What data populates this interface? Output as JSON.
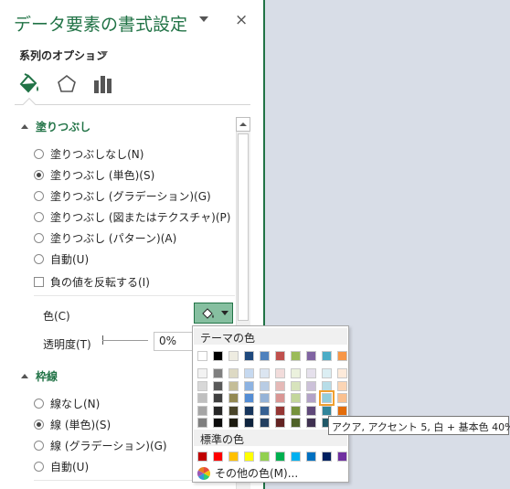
{
  "pane": {
    "title": "データ要素の書式設定",
    "close_glyph": "×",
    "series_options_label": "系列のオプション",
    "tabs": [
      {
        "icon": "paint-bucket-icon",
        "selected": true
      },
      {
        "icon": "pentagon-icon",
        "selected": false
      },
      {
        "icon": "bar-chart-icon",
        "selected": false
      }
    ]
  },
  "fill": {
    "heading": "塗りつぶし",
    "options": [
      {
        "label": "塗りつぶしなし(N)",
        "selected": false
      },
      {
        "label": "塗りつぶし (単色)(S)",
        "selected": true
      },
      {
        "label": "塗りつぶし (グラデーション)(G)",
        "selected": false
      },
      {
        "label": "塗りつぶし (図またはテクスチャ)(P)",
        "selected": false
      },
      {
        "label": "塗りつぶし (パターン)(A)",
        "selected": false
      },
      {
        "label": "自動(U)",
        "selected": false
      }
    ],
    "invert_label": "負の値を反転する(I)",
    "invert_checked": false,
    "color_label": "色(C)",
    "transparency_label": "透明度(T)",
    "transparency_value": "0%"
  },
  "border": {
    "heading": "枠線",
    "options": [
      {
        "label": "線なし(N)",
        "selected": false
      },
      {
        "label": "線 (単色)(S)",
        "selected": true
      },
      {
        "label": "線 (グラデーション)(G)",
        "selected": false
      },
      {
        "label": "自動(U)",
        "selected": false
      }
    ]
  },
  "color_picker": {
    "theme_heading": "テーマの色",
    "standard_heading": "標準の色",
    "more_colors": "その他の色(M)...",
    "theme_top": [
      "#ffffff",
      "#000000",
      "#e7e6e6",
      "#44546a",
      "#4472c4",
      "#ed7d31",
      "#a5a5a5",
      "#ffc000",
      "#5b9bd5",
      "#70ad47"
    ],
    "theme_top_display": [
      "#ffffff",
      "#000000",
      "#eeece1",
      "#1f497d",
      "#4f81bd",
      "#c0504d",
      "#9bbb59",
      "#8064a2",
      "#4bacc6",
      "#f79646"
    ],
    "theme_shades": [
      [
        "#f2f2f2",
        "#7f7f7f",
        "#ddd9c3",
        "#c6d9f0",
        "#dbe5f1",
        "#f2dcdb",
        "#ebf1dd",
        "#e5e0ec",
        "#dbeef3",
        "#fdeada"
      ],
      [
        "#d8d8d8",
        "#595959",
        "#c4bd97",
        "#8db3e2",
        "#b8cce4",
        "#e5b9b7",
        "#d7e3bc",
        "#ccc1d9",
        "#b7dde8",
        "#fbd5b5"
      ],
      [
        "#bfbfbf",
        "#3f3f3f",
        "#938953",
        "#548dd4",
        "#95b3d7",
        "#d99694",
        "#c3d69b",
        "#b2a2c7",
        "#92cddc",
        "#fac08f"
      ],
      [
        "#a5a5a5",
        "#262626",
        "#494429",
        "#17365d",
        "#366092",
        "#953734",
        "#76923c",
        "#5f497a",
        "#31859b",
        "#e36c09"
      ],
      [
        "#7f7f7f",
        "#0c0c0c",
        "#1d1b10",
        "#0f243e",
        "#244061",
        "#632423",
        "#4f6128",
        "#3f3151",
        "#205867",
        "#974806"
      ]
    ],
    "standard": [
      "#c00000",
      "#ff0000",
      "#ffc000",
      "#ffff00",
      "#92d050",
      "#00b050",
      "#00b0f0",
      "#0070c0",
      "#002060",
      "#7030a0"
    ],
    "selected_cell": {
      "row": 2,
      "col": 8
    }
  },
  "tooltip": "アクア, アクセント 5, 白 + 基本色 40%"
}
